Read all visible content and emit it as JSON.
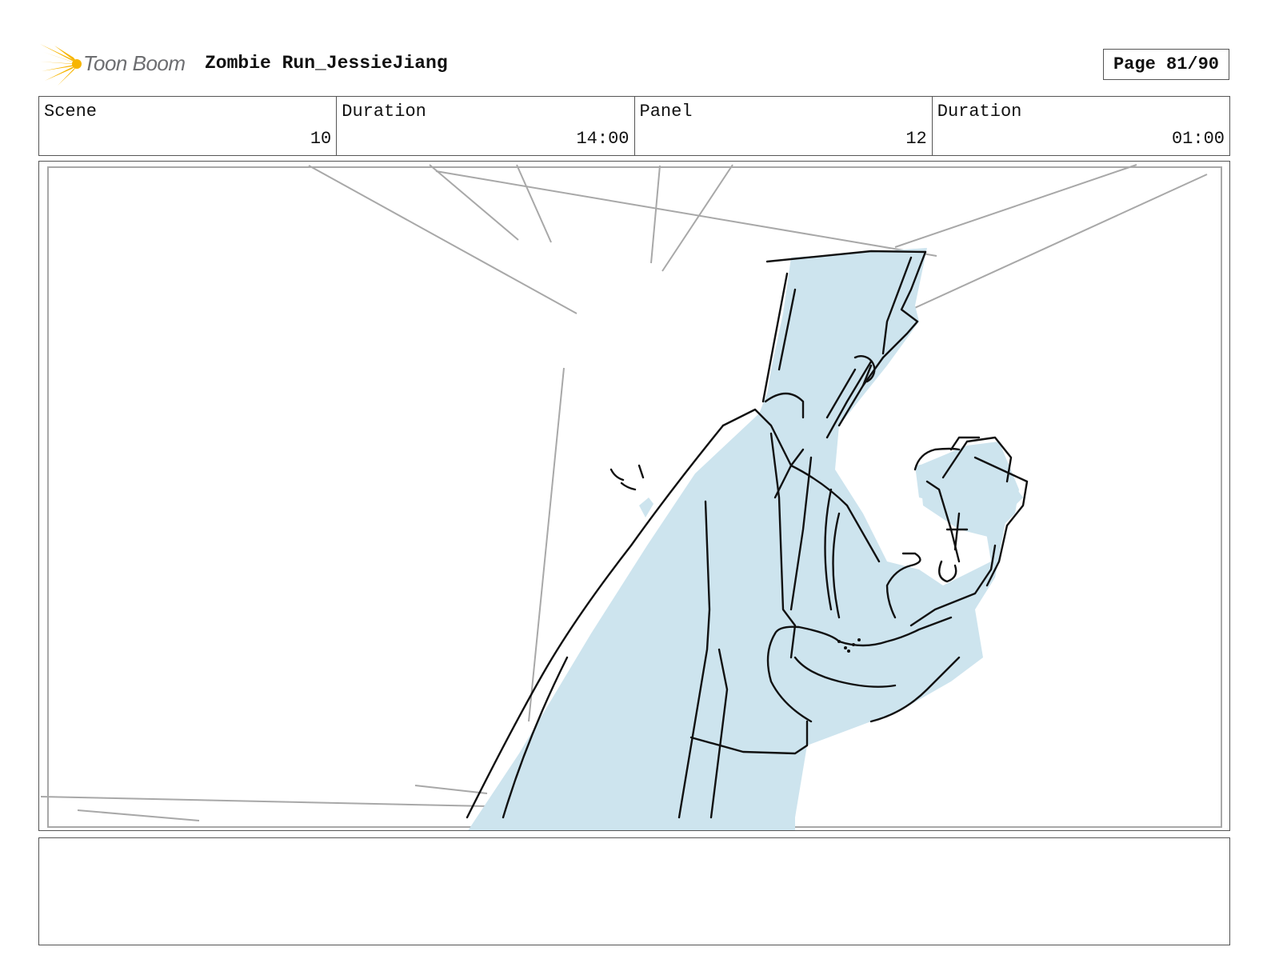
{
  "header": {
    "logo_text": "Toon Boom",
    "title": "Zombie Run_JessieJiang",
    "page": "Page 81/90"
  },
  "info": [
    {
      "label": "Scene",
      "value": "10"
    },
    {
      "label": "Duration",
      "value": "14:00"
    },
    {
      "label": "Panel",
      "value": "12"
    },
    {
      "label": "Duration",
      "value": "01:00"
    }
  ],
  "colors": {
    "sketch_fill": "#cde4ee",
    "sketch_line": "#111111",
    "guide_line": "#a8a8a8",
    "logo_yellow": "#f7b500",
    "logo_text": "#6d6e71"
  },
  "notes": ""
}
